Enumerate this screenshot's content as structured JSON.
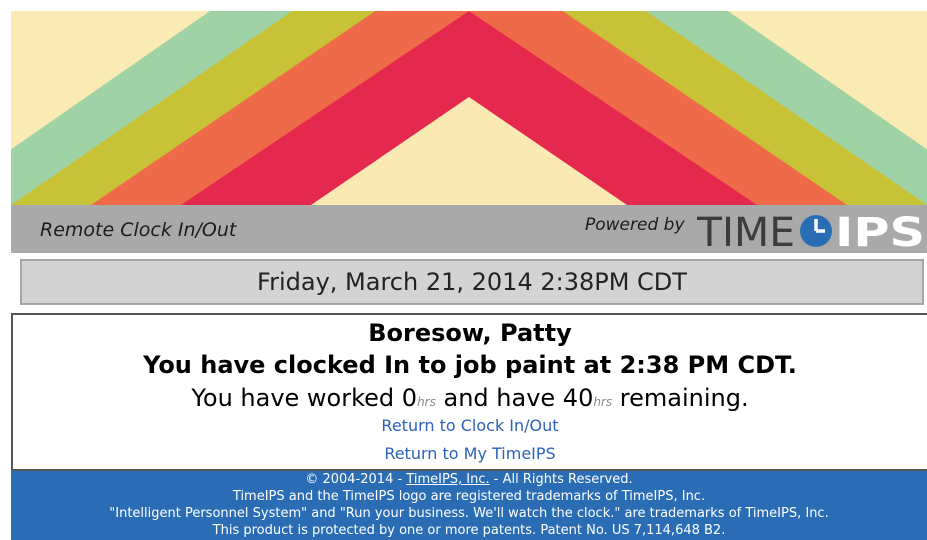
{
  "banner": {
    "colors": {
      "background": "#fbeab3",
      "stripe_outer": "#9fd3a6",
      "stripe_2": "#c8c336",
      "stripe_3": "#ee6a48",
      "stripe_inner": "#e5294e",
      "center": "#fbe9b3"
    }
  },
  "header": {
    "title": "Remote Clock In/Out",
    "powered_by": "Powered by",
    "logo": {
      "text_left": "TIME",
      "text_right": "IPS",
      "colors": {
        "time": "#3c3c3c",
        "ips": "#ffffff",
        "clock": "#2b6db5"
      }
    }
  },
  "datetime": {
    "display": "Friday, March 21, 2014 2:38PM CDT"
  },
  "message": {
    "employee_name": "Boresow, Patty",
    "status": "You have clocked In to job paint at 2:38 PM CDT.",
    "hours": {
      "prefix": "You have worked ",
      "worked": "0",
      "unit": "hrs",
      "middle": " and have ",
      "remaining": "40",
      "suffix": " remaining."
    }
  },
  "links": {
    "return_clock": "Return to Clock In/Out",
    "return_mytimeips": "Return to My TimeIPS"
  },
  "footer": {
    "copyright_prefix": "© 2004-2014 - ",
    "company": "TimeIPS, Inc.",
    "copyright_suffix": " - All Rights Reserved.",
    "trademark_1": "TimeIPS and the TimeIPS logo are registered trademarks of TimeIPS, Inc.",
    "trademark_2": "\"Intelligent Personnel System\" and \"Run your business. We'll watch the clock.\" are trademarks of TimeIPS, Inc.",
    "patent": "This product is protected by one or more patents. Patent No. US 7,114,648 B2."
  },
  "theme": {
    "title_bar": "#a9a9a9",
    "footer": "#2b6db5",
    "link": "#2e62b8"
  }
}
